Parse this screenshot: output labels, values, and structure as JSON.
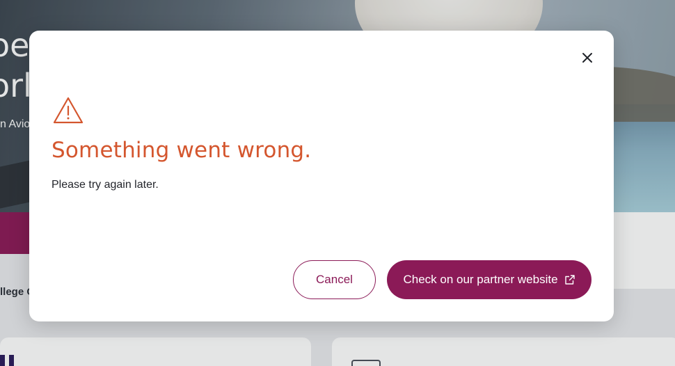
{
  "background": {
    "hero_title_line1": "oe",
    "hero_title_line2": "orld",
    "hero_subtitle": "n Avio",
    "left_label": "llege C"
  },
  "modal": {
    "title": "Something went wrong.",
    "message": "Please try again later.",
    "close_icon": "close-icon",
    "warning_icon": "warning-triangle-icon",
    "buttons": {
      "cancel_label": "Cancel",
      "partner_label": "Check on our partner website",
      "partner_icon": "external-link-icon"
    }
  },
  "colors": {
    "accent": "#8b1a57",
    "error_title": "#d4562e",
    "warning_icon": "#d4562e",
    "text": "#23252b"
  }
}
